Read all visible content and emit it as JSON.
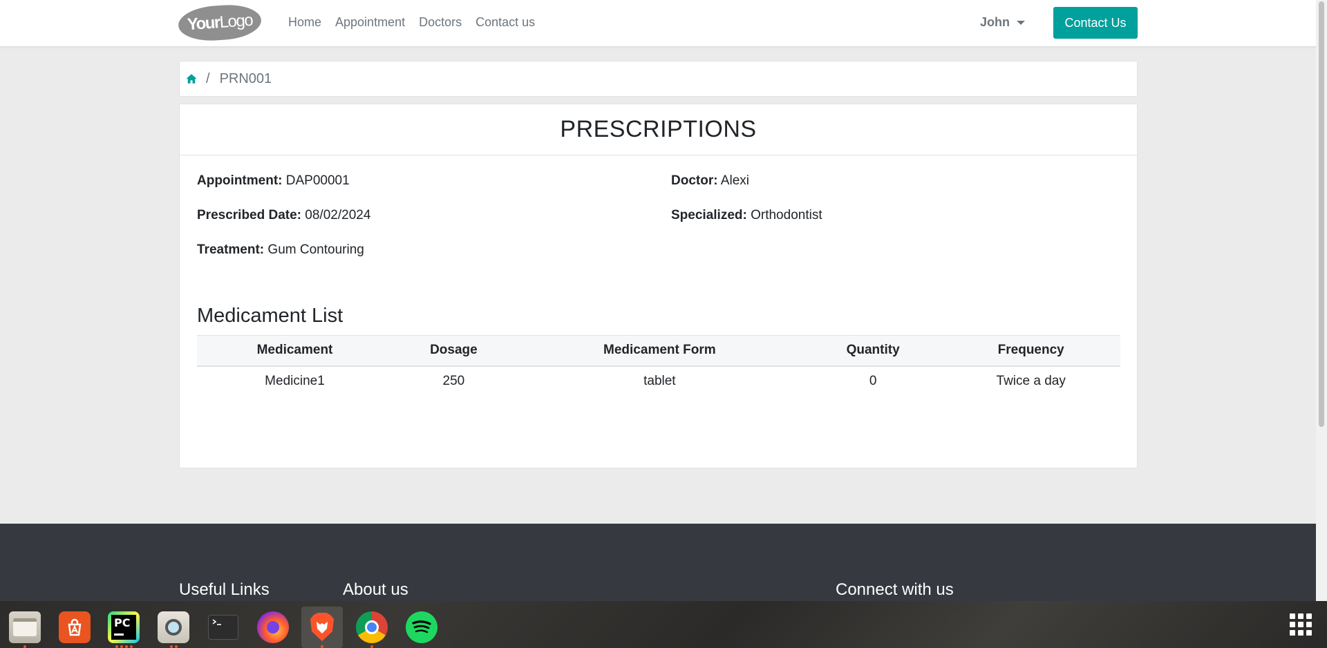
{
  "navbar": {
    "logo_text_bold": "Your",
    "logo_text_light": "Logo",
    "links": [
      {
        "label": "Home"
      },
      {
        "label": "Appointment"
      },
      {
        "label": "Doctors"
      },
      {
        "label": "Contact us"
      }
    ],
    "user_name": "John",
    "contact_button": "Contact Us",
    "accent_color": "#00a09d"
  },
  "breadcrumb": {
    "home_icon": "home-icon",
    "separator": "/",
    "current": "PRN001"
  },
  "prescription": {
    "title": "PRESCRIPTIONS",
    "appointment_label": "Appointment:",
    "appointment_value": "DAP00001",
    "prescribed_date_label": "Prescribed Date:",
    "prescribed_date_value": "08/02/2024",
    "treatment_label": "Treatment:",
    "treatment_value": "Gum Contouring",
    "doctor_label": "Doctor:",
    "doctor_value": "Alexi",
    "specialized_label": "Specialized:",
    "specialized_value": "Orthodontist"
  },
  "medicament_list": {
    "title": "Medicament List",
    "columns": [
      "Medicament",
      "Dosage",
      "Medicament Form",
      "Quantity",
      "Frequency"
    ],
    "rows": [
      [
        "Medicine1",
        "250",
        "tablet",
        "0",
        "Twice a day"
      ]
    ]
  },
  "footer": {
    "useful_links": "Useful Links",
    "about_us": "About us",
    "connect": "Connect with us",
    "background": "#363a40"
  },
  "taskbar": {
    "apps": [
      {
        "icon": "files-icon"
      },
      {
        "icon": "app-center-icon"
      },
      {
        "icon": "pycharm-icon",
        "label": "PC"
      },
      {
        "icon": "image-viewer-icon"
      },
      {
        "icon": "terminal-icon"
      },
      {
        "icon": "firefox-icon"
      },
      {
        "icon": "brave-icon"
      },
      {
        "icon": "chrome-icon"
      },
      {
        "icon": "spotify-icon"
      }
    ],
    "show_apps_icon": "apps-grid-icon"
  }
}
